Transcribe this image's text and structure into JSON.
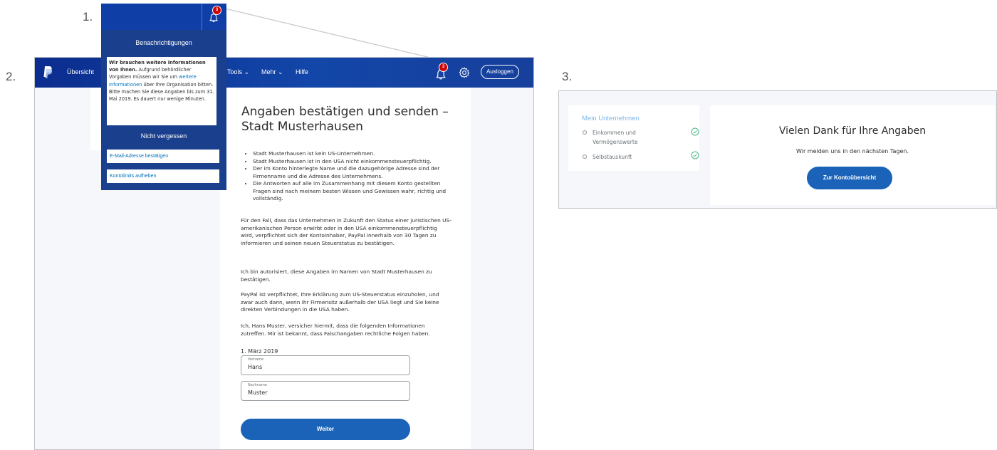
{
  "step_numbers": [
    "1.",
    "2.",
    "3."
  ],
  "colors": {
    "navbar": "#0b2d8f",
    "primary_button": "#1a63b8",
    "link": "#0070ba",
    "badge": "#d20000",
    "check": "#4cb58a"
  },
  "navbar": {
    "logo_icon": "paypal-logo",
    "items": [
      "Übersicht",
      "Tools",
      "Mehr",
      "Hilfe"
    ],
    "notification_count": "3",
    "bell_icon": "bell-icon",
    "settings_icon": "gear-icon",
    "logout_label": "Ausloggen"
  },
  "notifications": {
    "heading": "Benachrichtigungen",
    "badge_count": "3",
    "notice": {
      "bold": "Wir brauchen weitere Informationen von Ihnen.",
      "text1": " Aufgrund behördlicher Vorgaben müssen wir Sie um ",
      "link": "weitere Informationen",
      "text2": " über Ihre Organisation bitten. Bitte machen Sie diese Angaben bis zum 31. Mai 2019. Es dauert nur wenige Minuten."
    },
    "reminders_heading": "Nicht vergessen",
    "reminders": [
      "E-Mail-Adresse bestätigen",
      "Kontolimits aufheben"
    ]
  },
  "form": {
    "title": "Angaben bestätigen und senden – Stadt Musterhausen",
    "bullets": [
      "Stadt Musterhausen ist kein US-Unternehmen.",
      "Stadt Musterhausen ist in den USA nicht einkommensteuerpflichtig.",
      "Der im Konto hinterlegte Name und die dazugehörige Adresse sind der Firmenname und die Adresse des Unternehmens.",
      "Die Antworten auf alle im Zusammenhang mit diesem Konto gestellten Fragen sind nach meinem besten Wissen und Gewissen wahr, richtig und vollständig."
    ],
    "paragraphs": [
      "Für den Fall, dass das Unternehmen in Zukunft den Status einer juristischen US-amerikanischen Person erwirbt oder in den USA einkommensteuerpflichtig wird, verpflichtet sich der Kontoinhaber, PayPal innerhalb von 30 Tagen zu informieren und seinen neuen Steuerstatus zu bestätigen.",
      "Ich bin autorisiert, diese Angaben im Namen von Stadt Musterhausen zu bestätigen.",
      "PayPal ist verpflichtet, Ihre Erklärung zum US-Steuerstatus einzuholen, und zwar auch dann, wenn Ihr Firmensitz außerhalb der USA liegt und Sie keine direkten Verbindungen in die USA haben.",
      "Ich, Hans Muster, versicher hiermit, dass die folgenden Informationen zutreffen. Mir ist bekannt, dass Falschangaben rechtliche Folgen haben."
    ],
    "date": "1. März 2019",
    "first_name": {
      "label": "Vorname",
      "value": "Hans"
    },
    "last_name": {
      "label": "Nachname",
      "value": "Muster"
    },
    "submit_label": "Weiter"
  },
  "confirmation": {
    "sidebar_title": "Mein Unternehmen",
    "sidebar_items": [
      {
        "label": "Einkommen und Vermögenswerte",
        "status_icon": "check-circle-icon"
      },
      {
        "label": "Selbstauskunft",
        "status_icon": "check-circle-icon"
      }
    ],
    "title": "Vielen Dank für Ihre Angaben",
    "subtitle": "Wir melden uns in den nächsten Tagen.",
    "button_label": "Zur Kontoübersicht"
  }
}
